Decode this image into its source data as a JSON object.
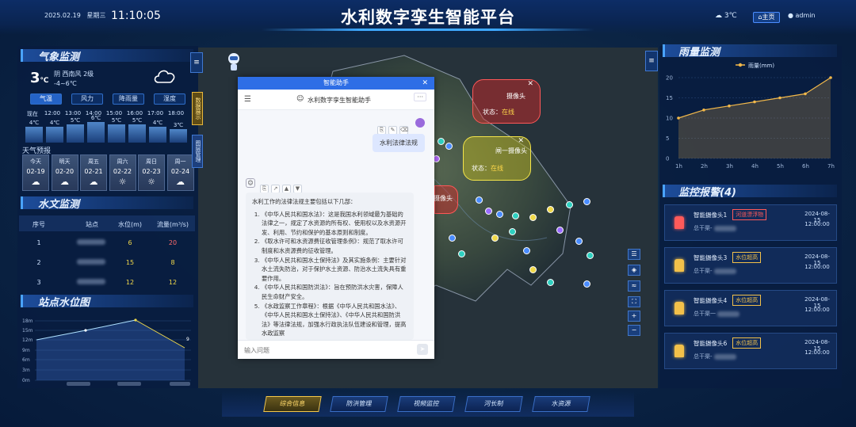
{
  "header": {
    "date": "2025.02.19",
    "weekday": "星期三",
    "time": "11:10:05",
    "title": "水利数字孪生智能平台",
    "weather_temp": "3℃",
    "home_label": "主页",
    "user": "admin"
  },
  "weather": {
    "section_title": "气象监测",
    "temp": "3",
    "temp_unit": "℃",
    "desc": "阴  西南风 2级",
    "range": "-4~6℃",
    "tabs": [
      "气温",
      "风力",
      "降雨量",
      "湿度"
    ],
    "hours": [
      "现在",
      "12:00",
      "13:00",
      "14:00",
      "15:00",
      "16:00",
      "17:00",
      "18:00"
    ],
    "hourly_temps": [
      4,
      4,
      5,
      6,
      5,
      5,
      4,
      3
    ],
    "hourly_labels": [
      "4℃",
      "4℃",
      "5℃",
      "6℃",
      "5℃",
      "5℃",
      "4℃",
      "3℃"
    ],
    "forecast_label": "天气预报",
    "forecast": [
      {
        "day": "今天",
        "date": "02-19",
        "icon": "☁"
      },
      {
        "day": "明天",
        "date": "02-20",
        "icon": "☁"
      },
      {
        "day": "周五",
        "date": "02-21",
        "icon": "☁"
      },
      {
        "day": "周六",
        "date": "02-22",
        "icon": "☼"
      },
      {
        "day": "周日",
        "date": "02-23",
        "icon": "☼"
      },
      {
        "day": "周一",
        "date": "02-24",
        "icon": "☁"
      }
    ]
  },
  "hydro": {
    "section_title": "水文监测",
    "headers": [
      "序号",
      "站点",
      "水位(m)",
      "流量(m³/s)"
    ],
    "rows": [
      {
        "no": "1",
        "level": "6",
        "flow": "20"
      },
      {
        "no": "2",
        "level": "15",
        "flow": "8"
      },
      {
        "no": "3",
        "level": "12",
        "flow": "12"
      }
    ]
  },
  "station_level": {
    "section_title": "站点水位图",
    "y_ticks": [
      "18m",
      "15m",
      "12m",
      "9m",
      "6m",
      "3m",
      "0m"
    ],
    "end_label": "9"
  },
  "rain": {
    "section_title": "雨量监测",
    "legend": "雨量(mm)",
    "chart_data": {
      "type": "line",
      "x": [
        "1h",
        "2h",
        "3h",
        "4h",
        "5h",
        "6h",
        "7h"
      ],
      "y_ticks": [
        "20",
        "15",
        "10",
        "5",
        "0"
      ],
      "series": [
        {
          "name": "雨量(mm)",
          "values": [
            10,
            12,
            13,
            14,
            15,
            16,
            20
          ]
        }
      ],
      "ylim": [
        0,
        20
      ]
    }
  },
  "alarms": {
    "section_title": "监控报警(4)",
    "items": [
      {
        "name": "智能摄像头1",
        "tag": "河道漂浮物",
        "sub": "总干渠-",
        "date": "2024-08-15",
        "time": "12:00:00",
        "color": "#ff5a5a"
      },
      {
        "name": "智能摄像头3",
        "tag": "水位超高",
        "sub": "总干渠-",
        "date": "2024-08-15",
        "time": "12:00:00",
        "color": "#f2c04a"
      },
      {
        "name": "智能摄像头4",
        "tag": "水位超高",
        "sub": "总干渠一",
        "date": "2024-08-15",
        "time": "12:00:00",
        "color": "#f2c04a"
      },
      {
        "name": "智能摄像头6",
        "tag": "水位超高",
        "sub": "总干渠-",
        "date": "2024-08-15",
        "time": "12:00:00",
        "color": "#f2c04a"
      }
    ]
  },
  "map": {
    "red_label": "摄像头",
    "red_status_key": "状态：",
    "red_status_val": "在线",
    "yellow_label": "闸一摄像头",
    "yellow_status_key": "状态：",
    "yellow_status_val": "在线",
    "left_label": "摄像头",
    "side_tabs": [
      "数据展示",
      "图层管理"
    ]
  },
  "chat": {
    "window_title": "智能助手",
    "header_title": "水利数字孪生智能助手",
    "user_msg": "水利法律法规",
    "ai_intro": "水利工作的法律法规主要包括以下几部：",
    "ai_items": [
      "《中华人民共和国水法》：这是我国水利领域最为基础的法律之一，规定了水资源的所有权、使用权以及水资源开发、利用、节约和保护的基本原则和制度。",
      "《取水许可和水资源费征收管理条例》：规范了取水许可制度和水资源费的征收管理。",
      "《中华人民共和国水土保持法》及其实施条例：主要针对水土流失防治，对于保护水土资源、防治水土流失具有重要作用。",
      "《中华人民共和国防洪法》：旨在预防洪水灾害，保障人民生命财产安全。",
      "《水政监察工作章程》：根据《中华人民共和国水法》、《中华人民共和国水土保持法》、《中华人民共和国防洪法》等法律法规，加强水行政执法队伍建设和管理，提高水政监察"
    ],
    "input_placeholder": "输入问题"
  },
  "bottom_nav": [
    "综合信息",
    "防洪管理",
    "视频监控",
    "河长制",
    "水资源"
  ]
}
